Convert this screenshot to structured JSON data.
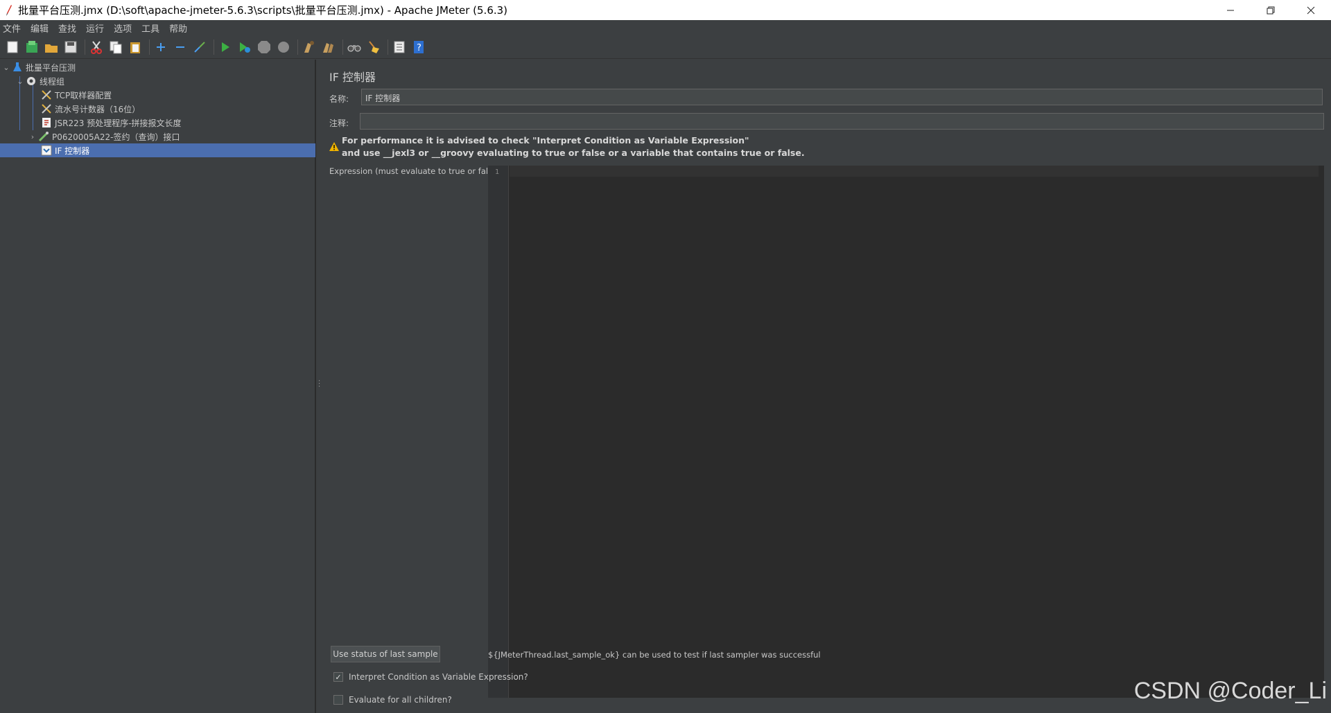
{
  "window": {
    "title": "批量平台压测.jmx (D:\\soft\\apache-jmeter-5.6.3\\scripts\\批量平台压测.jmx) - Apache JMeter (5.6.3)"
  },
  "menu": [
    "文件",
    "编辑",
    "查找",
    "运行",
    "选项",
    "工具",
    "帮助"
  ],
  "tree": {
    "items": [
      {
        "label": "批量平台压测",
        "icon": "test-plan-flask-icon"
      },
      {
        "label": "线程组",
        "icon": "thread-group-gear-icon"
      },
      {
        "label": "TCP取样器配置",
        "icon": "config-element-icon"
      },
      {
        "label": "流水号计数器（16位）",
        "icon": "counter-icon"
      },
      {
        "label": "JSR223 预处理程序-拼接报文长度",
        "icon": "preprocessor-icon"
      },
      {
        "label": "P0620005A22-签约（查询）接口",
        "icon": "sampler-pipette-icon"
      },
      {
        "label": "IF 控制器",
        "icon": "if-controller-icon"
      }
    ],
    "selected_index": 6
  },
  "panel": {
    "title": "IF 控制器",
    "name_label": "名称:",
    "name_value": "IF 控制器",
    "comment_label": "注释:",
    "comment_value": "",
    "warning_line1": "For performance it is advised to check \"Interpret Condition as Variable Expression\"",
    "warning_line2": "and use __jexl3 or __groovy evaluating to true or false or a variable that contains true or false.",
    "expression_label": "Expression (must evaluate to true or false)",
    "editor_line_number": "1",
    "use_status_button": "Use status of last sample",
    "hint_text": "${JMeterThread.last_sample_ok} can be used to test if last sampler was successful",
    "checkbox_interpret": {
      "label": "Interpret Condition as Variable Expression?",
      "checked": true
    },
    "checkbox_evaluate": {
      "label": "Evaluate for all children?",
      "checked": false
    }
  },
  "watermark": "CSDN @Coder_Li"
}
